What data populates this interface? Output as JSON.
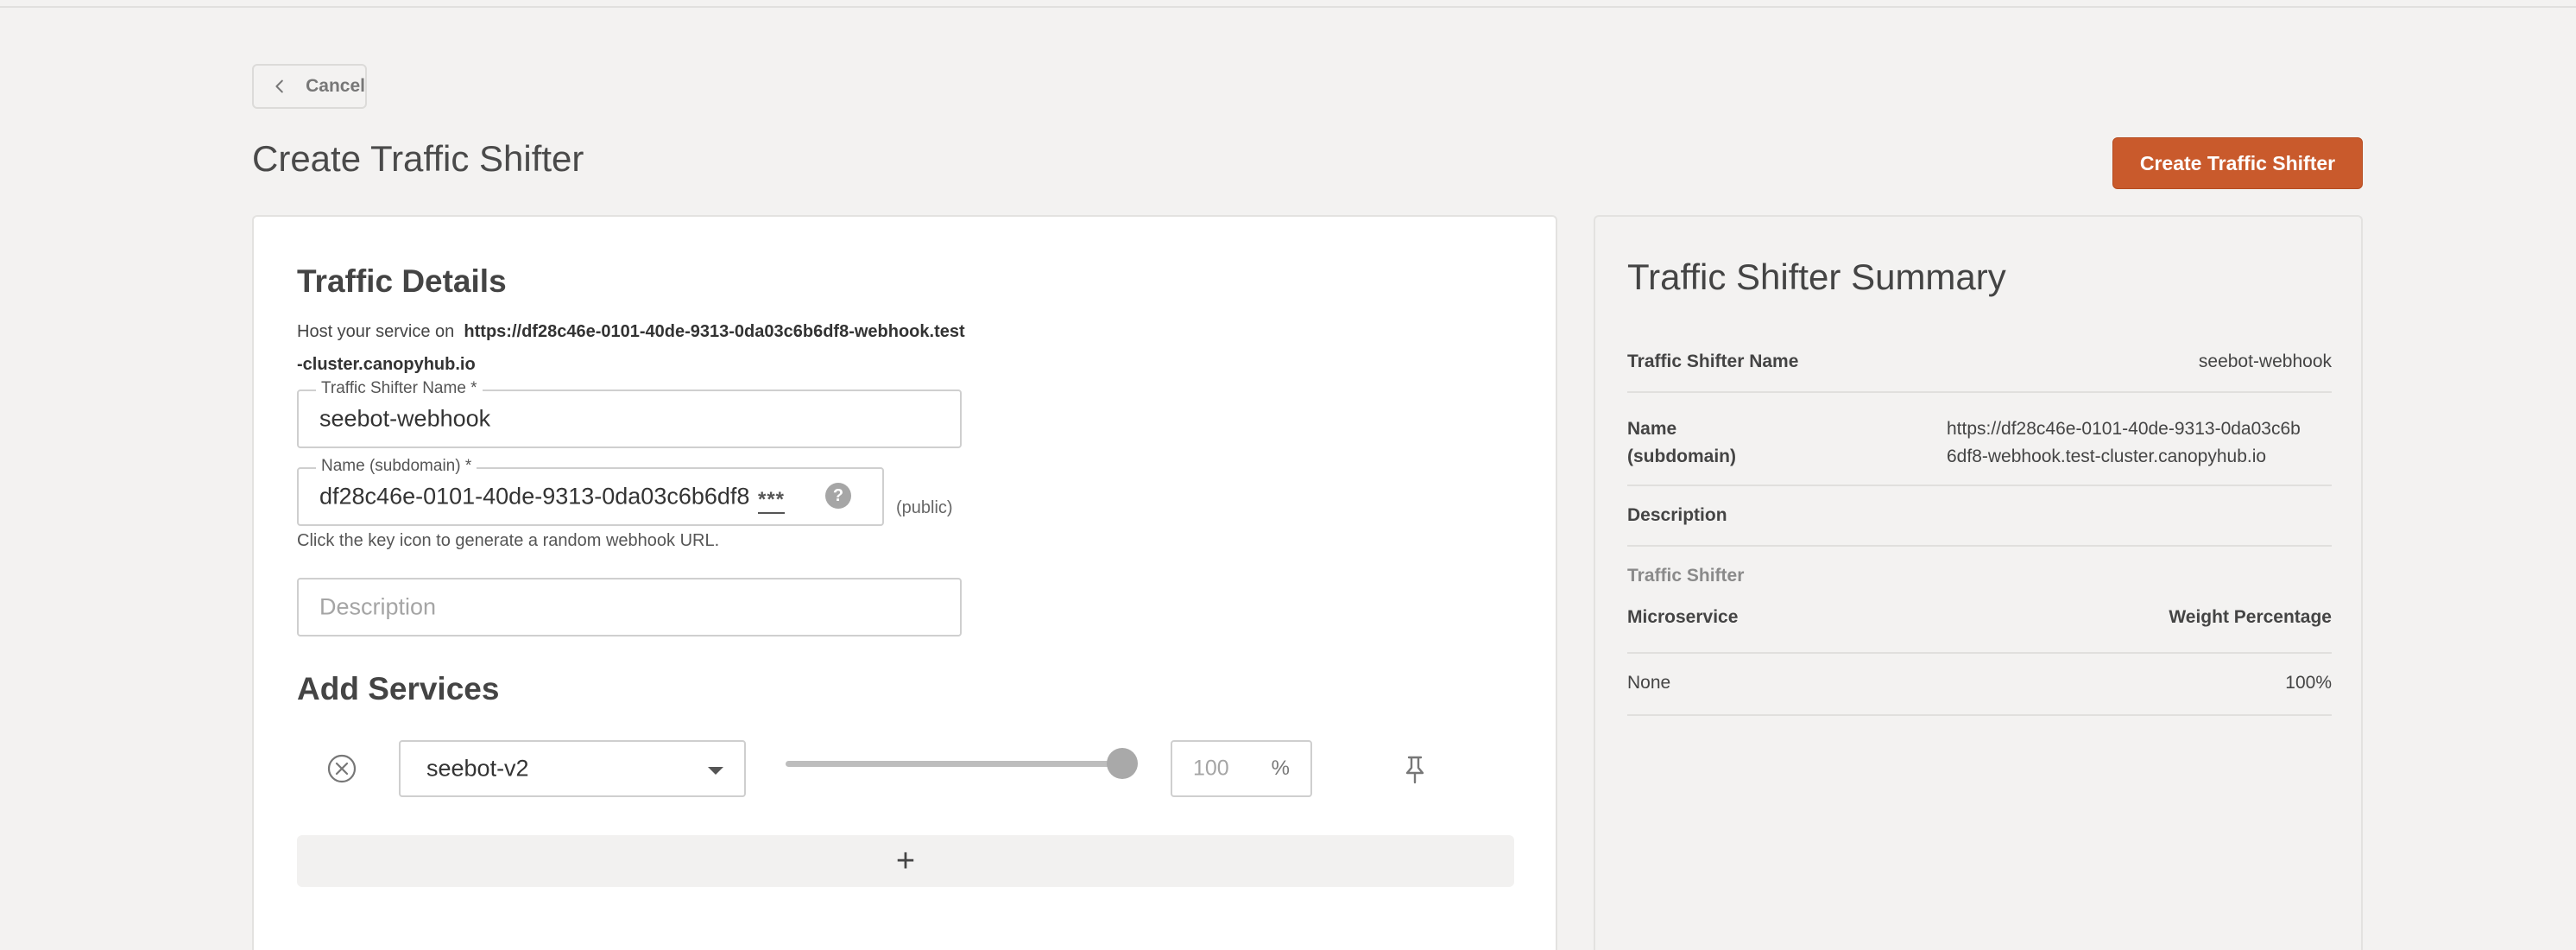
{
  "nav": {
    "cancel_label": "Cancel"
  },
  "page": {
    "title": "Create Traffic Shifter",
    "create_button": "Create Traffic Shifter"
  },
  "details": {
    "section_title": "Traffic Details",
    "host_prefix": "Host your service on",
    "host_url": "https://df28c46e-0101-40de-9313-0da03c6b6df8-webhook.test-cluster.canopyhub.io",
    "name_field": {
      "label": "Traffic Shifter Name *",
      "value": "seebot-webhook"
    },
    "subdomain_field": {
      "label": "Name (subdomain) *",
      "value": "df28c46e-0101-40de-9313-0da03c6b6df8",
      "mask": "***",
      "help": "?"
    },
    "public_label": "(public)",
    "hint": "Click the key icon to generate a random webhook URL.",
    "description_field": {
      "placeholder": "Description",
      "value": ""
    }
  },
  "services": {
    "section_title": "Add Services",
    "rows": [
      {
        "service": "seebot-v2",
        "weight": "100",
        "weight_fraction": 1.0,
        "unit": "%"
      }
    ],
    "add_label": "+"
  },
  "summary": {
    "title": "Traffic Shifter Summary",
    "name_key": "Traffic Shifter Name",
    "name_value": "seebot-webhook",
    "subdomain_key_1": "Name",
    "subdomain_key_2": "(subdomain)",
    "subdomain_value_1": "https://df28c46e-0101-40de-9313-0da03c6b",
    "subdomain_value_2": "6df8-webhook.test-cluster.canopyhub.io",
    "description_key": "Description",
    "traffic_label": "Traffic Shifter",
    "col_microservice": "Microservice",
    "col_weight": "Weight Percentage",
    "row_service": "None",
    "row_weight": "100%"
  },
  "colors": {
    "accent": "#c95a2c",
    "background": "#f3f2f1",
    "card": "#ffffff"
  }
}
